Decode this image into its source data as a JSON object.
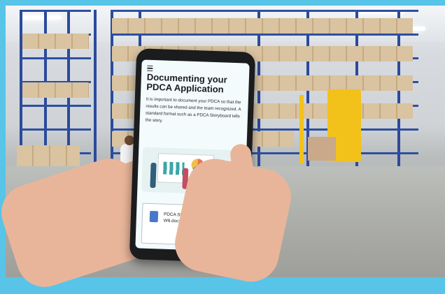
{
  "article": {
    "title": "Documenting your PDCA Application",
    "body": "It is important to document your PDCA so that the results can be shared and the team recognized. A standard format such as a PDCA Storyboard tells the story."
  },
  "attachment": {
    "label": "PDCA Storyboard Template - W8.docx"
  },
  "icons": {
    "menu": "hamburger-menu-icon",
    "document": "word-document-icon"
  },
  "colors": {
    "frame_accent": "#58c4e8",
    "rack_blue": "#2c4fa0",
    "forklift_yellow": "#f2c21b"
  }
}
